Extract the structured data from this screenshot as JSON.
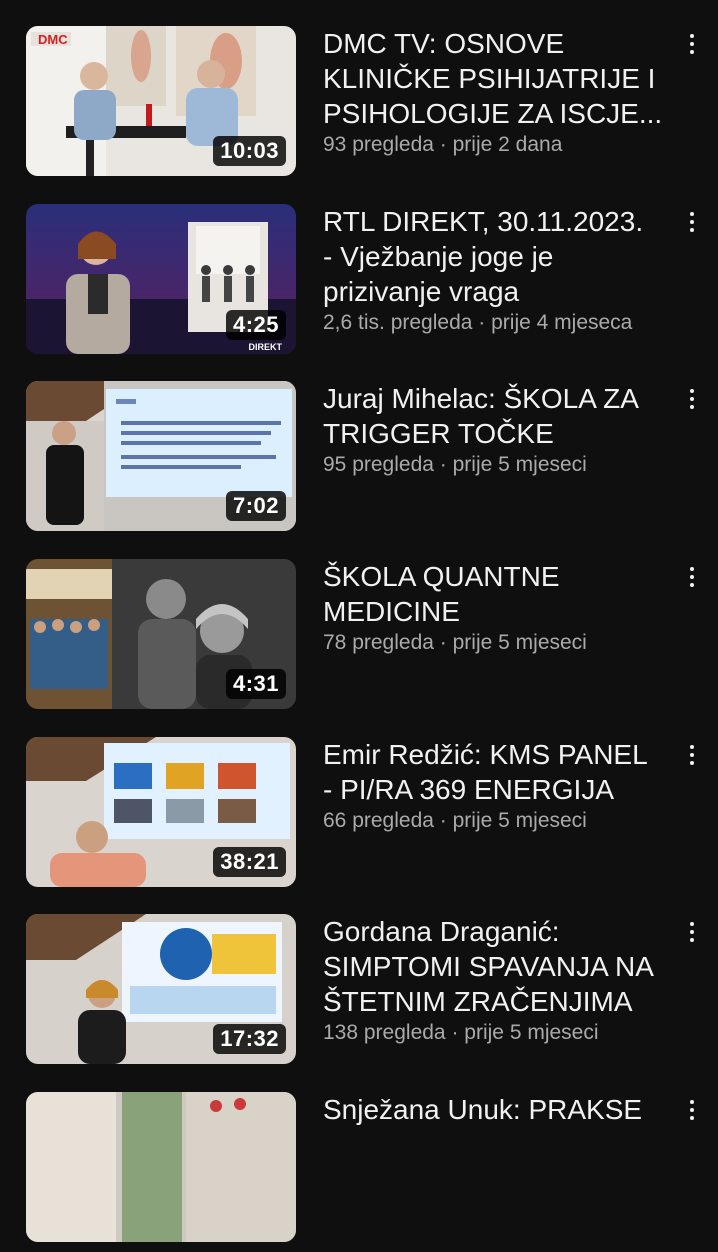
{
  "videos": [
    {
      "title": "DMC TV: OSNOVE\nKLINIČKE PSIHIJATRIJE I\nPSIHOLOGIJE ZA ISCJE...",
      "views": "93 pregleda",
      "separator": "·",
      "age": "prije 2 dana",
      "duration": "10:03",
      "logo": "DMC",
      "more_icon": "more-vertical-icon"
    },
    {
      "title": "RTL DIREKT, 30.11.2023.\n- Vježbanje joge je\nprizivanje vraga",
      "views": "2,6 tis. pregleda",
      "separator": "·",
      "age": "prije 4 mjeseca",
      "duration": "4:25",
      "logo": "DIREKT",
      "more_icon": "more-vertical-icon"
    },
    {
      "title": "Juraj Mihelac: ŠKOLA ZA\nTRIGGER TOČKE",
      "views": "95 pregleda",
      "separator": "·",
      "age": "prije 5 mjeseci",
      "duration": "7:02",
      "more_icon": "more-vertical-icon"
    },
    {
      "title": "ŠKOLA QUANTNE\nMEDICINE",
      "views": "78 pregleda",
      "separator": "·",
      "age": "prije 5 mjeseci",
      "duration": "4:31",
      "more_icon": "more-vertical-icon"
    },
    {
      "title": "Emir Redžić: KMS PANEL\n- PI/RA 369 ENERGIJA",
      "views": "66 pregleda",
      "separator": "·",
      "age": "prije 5 mjeseci",
      "duration": "38:21",
      "more_icon": "more-vertical-icon"
    },
    {
      "title": "Gordana Draganić:\nSIMPTOMI SPAVANJA NA\nŠTETNIM ZRAČENJIMA",
      "views": "138 pregleda",
      "separator": "·",
      "age": "prije 5 mjeseci",
      "duration": "17:32",
      "more_icon": "more-vertical-icon"
    },
    {
      "title": "Snježana Unuk: PRAKSE",
      "more_icon": "more-vertical-icon"
    }
  ],
  "colors": {
    "background": "#0f0f0f",
    "title_text": "#f1f1f1",
    "meta_text": "#aaaaaa",
    "duration_badge": "#000000"
  }
}
